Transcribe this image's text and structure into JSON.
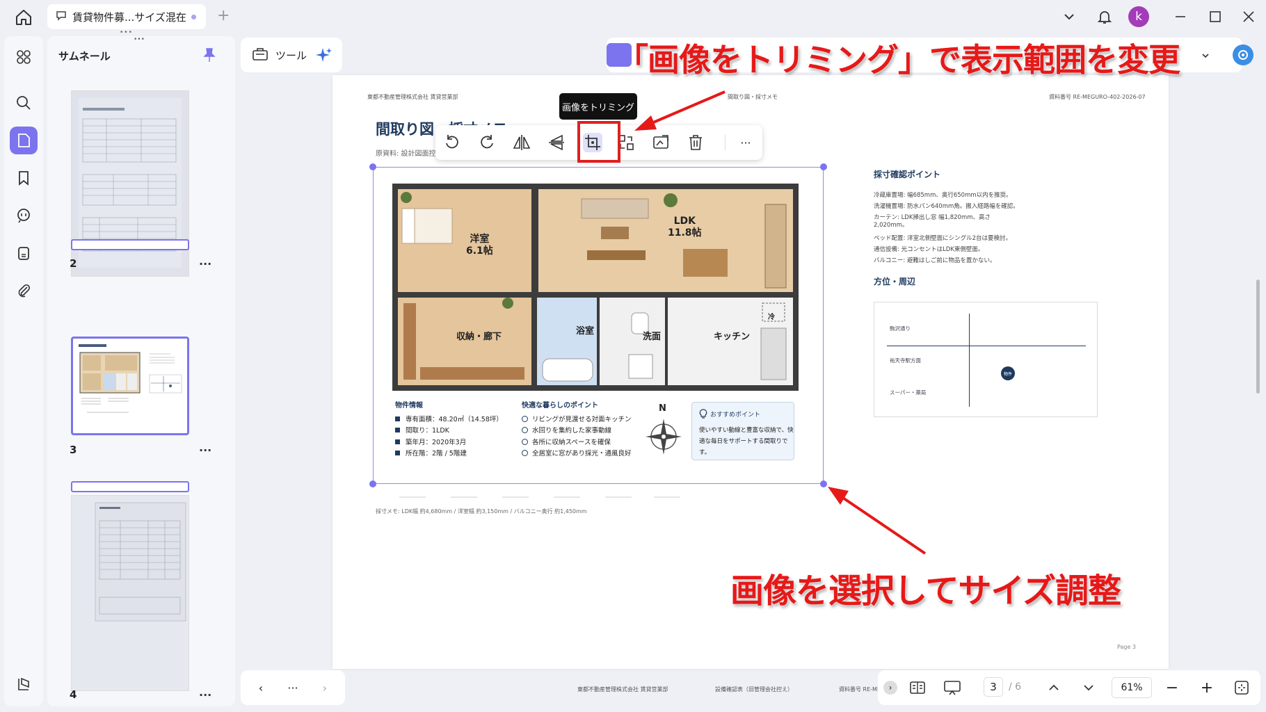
{
  "window": {
    "tab_title": "賃貸物件募...サイズ混在",
    "new_tab": "+",
    "avatar_letter": "k"
  },
  "sidebar": {
    "panel_title": "サムネール",
    "pages": [
      {
        "number": "2",
        "more": "..."
      },
      {
        "number": "3",
        "more": "..."
      },
      {
        "number": "4",
        "more": "..."
      }
    ]
  },
  "toolbar": {
    "tool_label": "ツール",
    "tooltip": "画像をトリミング",
    "more": "···"
  },
  "document": {
    "header_left": "東都不動産管理株式会社 賃貸営業部",
    "header_center": "間取り図・採寸メモ",
    "header_right": "資料番号 RE-MEGURO-402-2026-07",
    "title": "間取り図・採寸メモ",
    "source": "原資料: 設計図面控え",
    "sections": {
      "measure_title": "採寸確認ポイント",
      "measure_items": [
        "冷蔵庫置場: 幅685mm、奥行650mm以内を推奨。",
        "洗濯機置場: 防水パン640mm角。搬入経路幅を確認。",
        "カーテン: LDK掃出し窓 幅1,820mm、高さ2,020mm。",
        "ベッド配置: 洋室北側壁面にシングル2台は要検討。",
        "通信設備: 光コンセントはLDK東側壁面。",
        "バルコニー: 避難はしご前に物品を置かない。"
      ],
      "location_title": "方位・周辺",
      "map_labels": [
        "駒沢通り",
        "祐天寺駅方面",
        "スーパー・薬局"
      ],
      "map_pin": "物件"
    },
    "note": "採寸メモ: LDK幅 約4,680mm / 洋室幅 約3,150mm / バルコニー奥行 約1,450mm",
    "page_label": "Page 3"
  },
  "floorplan": {
    "rooms": {
      "western": [
        "洋室",
        "6.1帖"
      ],
      "ldk": [
        "LDK",
        "11.8帖"
      ],
      "storage": "収納・廊下",
      "bath": "浴室",
      "washroom": "洗面",
      "kitchen": "キッチン",
      "fridge": "冷"
    },
    "info_title": "物件情報",
    "info_items": [
      "専有面積：48.20㎡（14.58坪）",
      "間取り：1LDK",
      "築年月：2020年3月",
      "所在階：2階 / 5階建"
    ],
    "points_title": "快適な暮らしのポイント",
    "points_items": [
      "リビングが見渡せる対面キッチン",
      "水回りを集約した家事動線",
      "各所に収納スペースを確保",
      "全居室に窓があり採光・通風良好"
    ],
    "compass": "N",
    "recommend_title": "おすすめポイント",
    "recommend_body": "使いやすい動線と豊富な収納で、快適な毎日をサポートする間取りです。"
  },
  "annotations": {
    "top": "「画像をトリミング」で表示範囲を変更",
    "bottom": "画像を選択してサイズ調整"
  },
  "bottombar": {
    "prev": "‹",
    "more": "···",
    "next": "›",
    "current_page": "3",
    "total_pages": "/ 6",
    "zoom": "61%",
    "zoom_out": "−",
    "zoom_in": "+",
    "foot_left": "東都不動産管理株式会社 賃貸営業部",
    "foot_center": "設備確認表（旧管理会社控え）",
    "foot_right": "資料番号 RE-ME"
  },
  "colors": {
    "accent": "#7b74ee",
    "annotation": "#e61919",
    "navy": "#1e3a5f"
  }
}
